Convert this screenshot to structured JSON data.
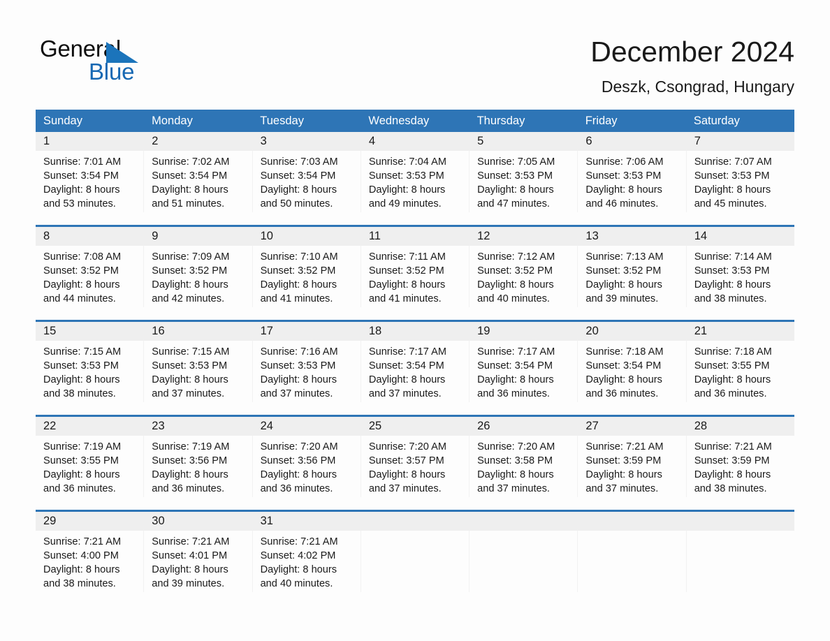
{
  "brand": {
    "name_top": "General",
    "name_bottom": "Blue",
    "accent_color": "#1668b3",
    "triangle_color": "#1b74bb"
  },
  "header": {
    "title": "December 2024",
    "subtitle": "Deszk, Csongrad, Hungary"
  },
  "theme": {
    "header_bg": "#2e75b6",
    "header_text": "#ffffff",
    "date_band_bg": "#efefef",
    "week_divider": "#2e75b6",
    "page_bg": "#fdfdfd",
    "body_text": "#1a1a1a"
  },
  "calendar": {
    "weekday_headers": [
      "Sunday",
      "Monday",
      "Tuesday",
      "Wednesday",
      "Thursday",
      "Friday",
      "Saturday"
    ],
    "weeks": [
      [
        {
          "day": "1",
          "sunrise": "Sunrise: 7:01 AM",
          "sunset": "Sunset: 3:54 PM",
          "daylight": "Daylight: 8 hours and 53 minutes."
        },
        {
          "day": "2",
          "sunrise": "Sunrise: 7:02 AM",
          "sunset": "Sunset: 3:54 PM",
          "daylight": "Daylight: 8 hours and 51 minutes."
        },
        {
          "day": "3",
          "sunrise": "Sunrise: 7:03 AM",
          "sunset": "Sunset: 3:54 PM",
          "daylight": "Daylight: 8 hours and 50 minutes."
        },
        {
          "day": "4",
          "sunrise": "Sunrise: 7:04 AM",
          "sunset": "Sunset: 3:53 PM",
          "daylight": "Daylight: 8 hours and 49 minutes."
        },
        {
          "day": "5",
          "sunrise": "Sunrise: 7:05 AM",
          "sunset": "Sunset: 3:53 PM",
          "daylight": "Daylight: 8 hours and 47 minutes."
        },
        {
          "day": "6",
          "sunrise": "Sunrise: 7:06 AM",
          "sunset": "Sunset: 3:53 PM",
          "daylight": "Daylight: 8 hours and 46 minutes."
        },
        {
          "day": "7",
          "sunrise": "Sunrise: 7:07 AM",
          "sunset": "Sunset: 3:53 PM",
          "daylight": "Daylight: 8 hours and 45 minutes."
        }
      ],
      [
        {
          "day": "8",
          "sunrise": "Sunrise: 7:08 AM",
          "sunset": "Sunset: 3:52 PM",
          "daylight": "Daylight: 8 hours and 44 minutes."
        },
        {
          "day": "9",
          "sunrise": "Sunrise: 7:09 AM",
          "sunset": "Sunset: 3:52 PM",
          "daylight": "Daylight: 8 hours and 42 minutes."
        },
        {
          "day": "10",
          "sunrise": "Sunrise: 7:10 AM",
          "sunset": "Sunset: 3:52 PM",
          "daylight": "Daylight: 8 hours and 41 minutes."
        },
        {
          "day": "11",
          "sunrise": "Sunrise: 7:11 AM",
          "sunset": "Sunset: 3:52 PM",
          "daylight": "Daylight: 8 hours and 41 minutes."
        },
        {
          "day": "12",
          "sunrise": "Sunrise: 7:12 AM",
          "sunset": "Sunset: 3:52 PM",
          "daylight": "Daylight: 8 hours and 40 minutes."
        },
        {
          "day": "13",
          "sunrise": "Sunrise: 7:13 AM",
          "sunset": "Sunset: 3:52 PM",
          "daylight": "Daylight: 8 hours and 39 minutes."
        },
        {
          "day": "14",
          "sunrise": "Sunrise: 7:14 AM",
          "sunset": "Sunset: 3:53 PM",
          "daylight": "Daylight: 8 hours and 38 minutes."
        }
      ],
      [
        {
          "day": "15",
          "sunrise": "Sunrise: 7:15 AM",
          "sunset": "Sunset: 3:53 PM",
          "daylight": "Daylight: 8 hours and 38 minutes."
        },
        {
          "day": "16",
          "sunrise": "Sunrise: 7:15 AM",
          "sunset": "Sunset: 3:53 PM",
          "daylight": "Daylight: 8 hours and 37 minutes."
        },
        {
          "day": "17",
          "sunrise": "Sunrise: 7:16 AM",
          "sunset": "Sunset: 3:53 PM",
          "daylight": "Daylight: 8 hours and 37 minutes."
        },
        {
          "day": "18",
          "sunrise": "Sunrise: 7:17 AM",
          "sunset": "Sunset: 3:54 PM",
          "daylight": "Daylight: 8 hours and 37 minutes."
        },
        {
          "day": "19",
          "sunrise": "Sunrise: 7:17 AM",
          "sunset": "Sunset: 3:54 PM",
          "daylight": "Daylight: 8 hours and 36 minutes."
        },
        {
          "day": "20",
          "sunrise": "Sunrise: 7:18 AM",
          "sunset": "Sunset: 3:54 PM",
          "daylight": "Daylight: 8 hours and 36 minutes."
        },
        {
          "day": "21",
          "sunrise": "Sunrise: 7:18 AM",
          "sunset": "Sunset: 3:55 PM",
          "daylight": "Daylight: 8 hours and 36 minutes."
        }
      ],
      [
        {
          "day": "22",
          "sunrise": "Sunrise: 7:19 AM",
          "sunset": "Sunset: 3:55 PM",
          "daylight": "Daylight: 8 hours and 36 minutes."
        },
        {
          "day": "23",
          "sunrise": "Sunrise: 7:19 AM",
          "sunset": "Sunset: 3:56 PM",
          "daylight": "Daylight: 8 hours and 36 minutes."
        },
        {
          "day": "24",
          "sunrise": "Sunrise: 7:20 AM",
          "sunset": "Sunset: 3:56 PM",
          "daylight": "Daylight: 8 hours and 36 minutes."
        },
        {
          "day": "25",
          "sunrise": "Sunrise: 7:20 AM",
          "sunset": "Sunset: 3:57 PM",
          "daylight": "Daylight: 8 hours and 37 minutes."
        },
        {
          "day": "26",
          "sunrise": "Sunrise: 7:20 AM",
          "sunset": "Sunset: 3:58 PM",
          "daylight": "Daylight: 8 hours and 37 minutes."
        },
        {
          "day": "27",
          "sunrise": "Sunrise: 7:21 AM",
          "sunset": "Sunset: 3:59 PM",
          "daylight": "Daylight: 8 hours and 37 minutes."
        },
        {
          "day": "28",
          "sunrise": "Sunrise: 7:21 AM",
          "sunset": "Sunset: 3:59 PM",
          "daylight": "Daylight: 8 hours and 38 minutes."
        }
      ],
      [
        {
          "day": "29",
          "sunrise": "Sunrise: 7:21 AM",
          "sunset": "Sunset: 4:00 PM",
          "daylight": "Daylight: 8 hours and 38 minutes."
        },
        {
          "day": "30",
          "sunrise": "Sunrise: 7:21 AM",
          "sunset": "Sunset: 4:01 PM",
          "daylight": "Daylight: 8 hours and 39 minutes."
        },
        {
          "day": "31",
          "sunrise": "Sunrise: 7:21 AM",
          "sunset": "Sunset: 4:02 PM",
          "daylight": "Daylight: 8 hours and 40 minutes."
        },
        {
          "day": "",
          "sunrise": "",
          "sunset": "",
          "daylight": ""
        },
        {
          "day": "",
          "sunrise": "",
          "sunset": "",
          "daylight": ""
        },
        {
          "day": "",
          "sunrise": "",
          "sunset": "",
          "daylight": ""
        },
        {
          "day": "",
          "sunrise": "",
          "sunset": "",
          "daylight": ""
        }
      ]
    ]
  }
}
